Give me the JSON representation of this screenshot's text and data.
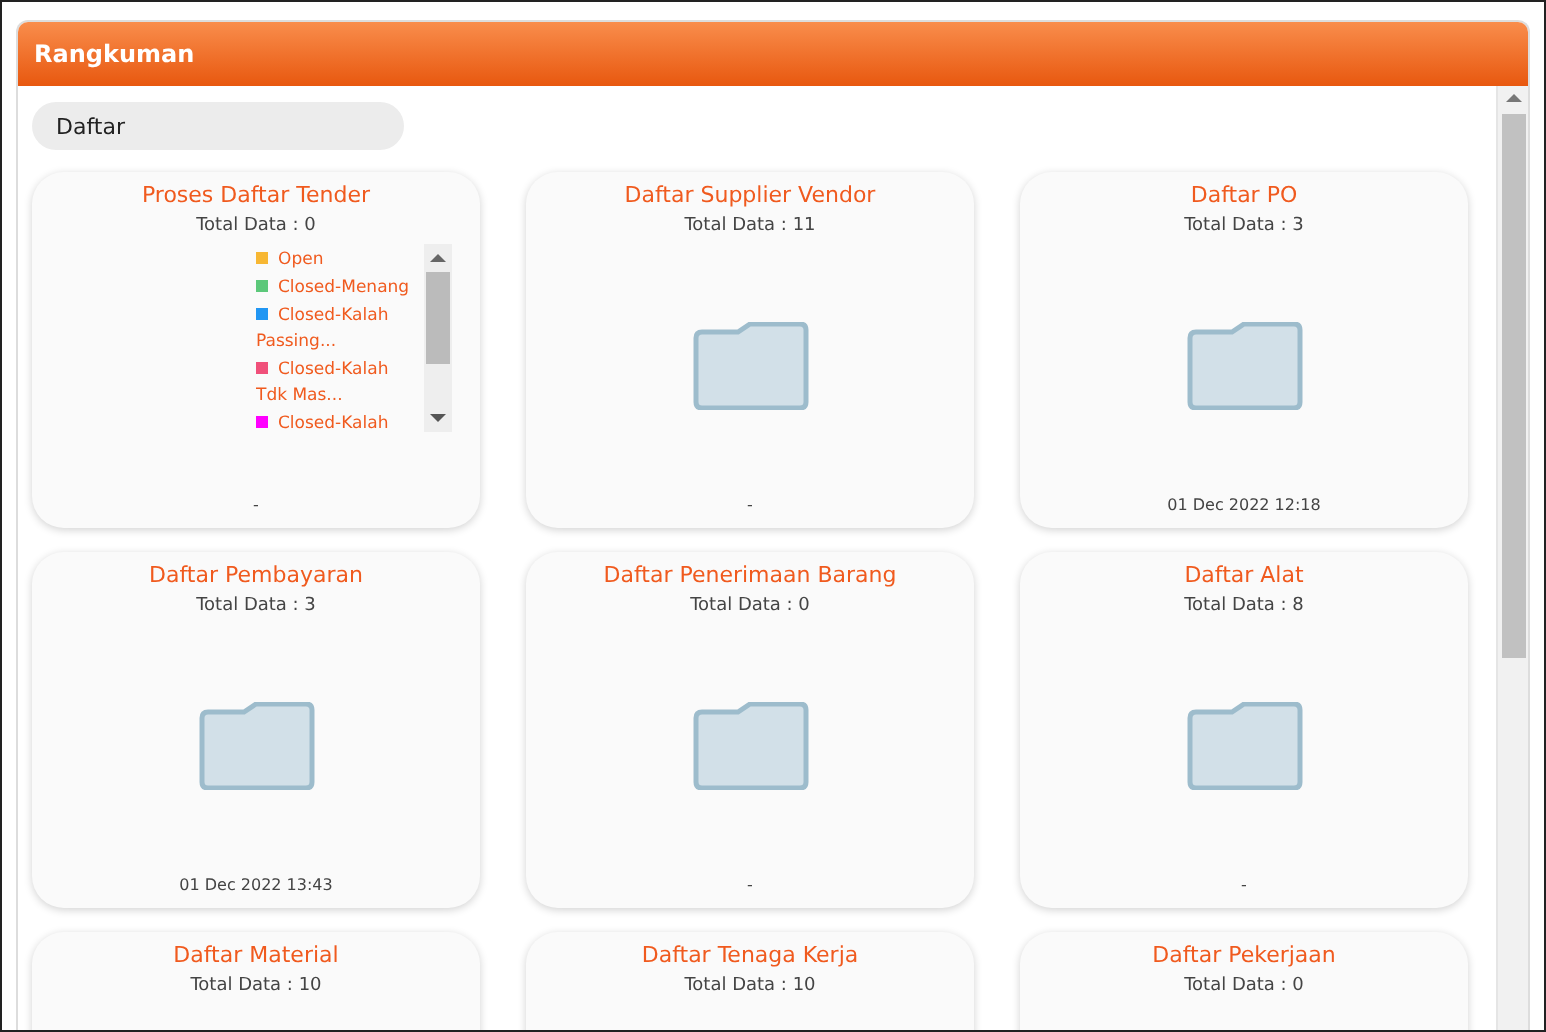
{
  "panel": {
    "title": "Rangkuman"
  },
  "tabs": [
    {
      "label": "Daftar",
      "selected": true
    }
  ],
  "cards": [
    {
      "kind": "chart",
      "title": "Proses Daftar Tender",
      "total": "Total Data : 0",
      "legend": [
        {
          "label": "Open",
          "color": "#f7b733"
        },
        {
          "label": "Closed-Menang",
          "color": "#5cc87a"
        },
        {
          "label": "Closed-Kalah Passing...",
          "color": "#2196f3"
        },
        {
          "label": "Closed-Kalah Tdk Mas...",
          "color": "#f0507a"
        },
        {
          "label": "Closed-Kalah",
          "color": "#ff00ff"
        }
      ],
      "footer": "-"
    },
    {
      "kind": "folder",
      "title": "Daftar Supplier Vendor",
      "total": "Total Data : 11",
      "footer": "-"
    },
    {
      "kind": "folder",
      "title": "Daftar PO",
      "total": "Total Data : 3",
      "footer": "01 Dec 2022 12:18"
    },
    {
      "kind": "folder",
      "title": "Daftar Pembayaran",
      "total": "Total Data : 3",
      "footer": "01 Dec 2022 13:43"
    },
    {
      "kind": "folder",
      "title": "Daftar Penerimaan Barang",
      "total": "Total Data : 0",
      "footer": "-"
    },
    {
      "kind": "folder",
      "title": "Daftar Alat",
      "total": "Total Data : 8",
      "footer": "-"
    },
    {
      "kind": "cut",
      "title": "Daftar Material",
      "total": "Total Data : 10"
    },
    {
      "kind": "cut",
      "title": "Daftar Tenaga Kerja",
      "total": "Total Data : 10"
    },
    {
      "kind": "cut",
      "title": "Daftar Pekerjaan",
      "total": "Total Data : 0"
    }
  ]
}
